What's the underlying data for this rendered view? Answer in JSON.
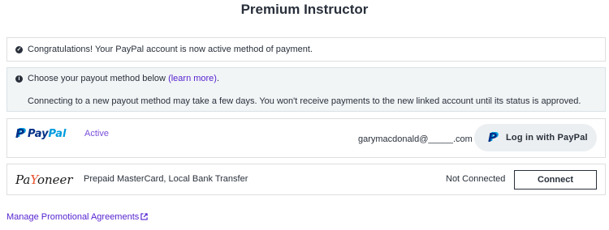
{
  "page": {
    "title": "Premium Instructor"
  },
  "alerts": {
    "success": {
      "icon": "check-circle-icon",
      "text": "Congratulations! Your PayPal account is now active method of payment."
    },
    "info": {
      "icon": "info-circle-icon",
      "line1_prefix": "Choose your payout method below",
      "line1_link": "(learn more)",
      "line1_suffix": ".",
      "line2": "Connecting to a new payout method may take a few days. You won't receive payments to the new linked account until its status is approved."
    }
  },
  "payout_methods": {
    "paypal": {
      "logo_mark": "P",
      "logo_pay": "Pay",
      "logo_pal": "Pal",
      "status": "Active",
      "email": "garymacdonald@_____.com",
      "button_label": "Log in with PayPal"
    },
    "payoneer": {
      "logo_pre": "Pa",
      "logo_swoosh": "Y",
      "logo_post": "oneer",
      "methods": "Prepaid MasterCard, Local Bank Transfer",
      "status": "Not Connected",
      "button_label": "Connect"
    }
  },
  "footer": {
    "manage_link": "Manage Promotional Agreements",
    "manage_icon": "external-link-icon"
  },
  "colors": {
    "accent": "#5624d0",
    "paypal_dark": "#003087",
    "paypal_light": "#009cde",
    "payoneer_orange": "#e8502b"
  }
}
